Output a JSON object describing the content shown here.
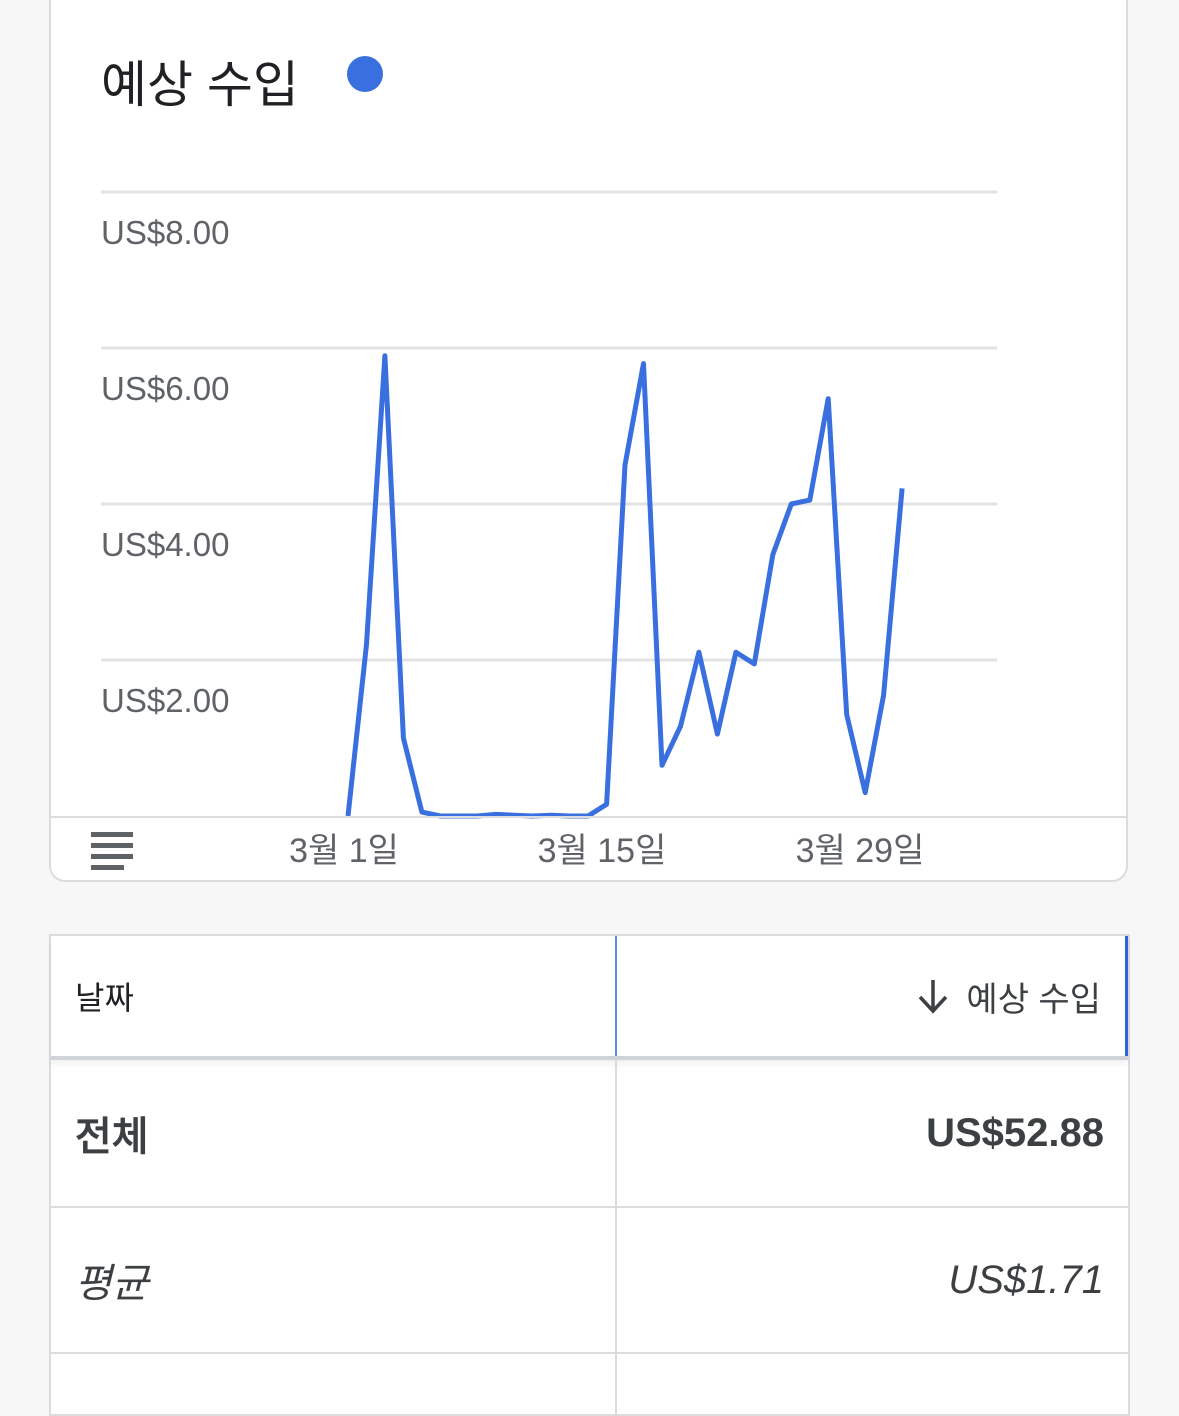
{
  "card": {
    "title": "예상 수입",
    "legend_color": "#3a6fe0"
  },
  "chart_data": {
    "type": "line",
    "title": "예상 수입",
    "y_ticks": [
      "US$2.00",
      "US$4.00",
      "US$6.00",
      "US$8.00"
    ],
    "x_ticks": [
      "3월 1일",
      "3월 15일",
      "3월 29일"
    ],
    "ylim": [
      0,
      8.5
    ],
    "grid": true,
    "series": [
      {
        "color": "#3a6fe0",
        "values": [
          0.0,
          2.2,
          5.9,
          1.0,
          0.05,
          0.0,
          0.0,
          0.0,
          0.02,
          0.01,
          0.0,
          0.01,
          0.0,
          0.0,
          0.15,
          4.5,
          5.8,
          0.65,
          1.15,
          2.1,
          1.05,
          2.1,
          1.95,
          3.35,
          4.0,
          4.05,
          5.35,
          1.3,
          0.3,
          1.55,
          4.2
        ]
      }
    ]
  },
  "menu_icon": "menu-icon",
  "table": {
    "header": {
      "date_label": "날짜",
      "revenue_label": "예상 수입",
      "sort_icon": "arrow-down-icon"
    },
    "total": {
      "label": "전체",
      "value": "US$52.88"
    },
    "average": {
      "label": "평균",
      "value": "US$1.71"
    }
  }
}
